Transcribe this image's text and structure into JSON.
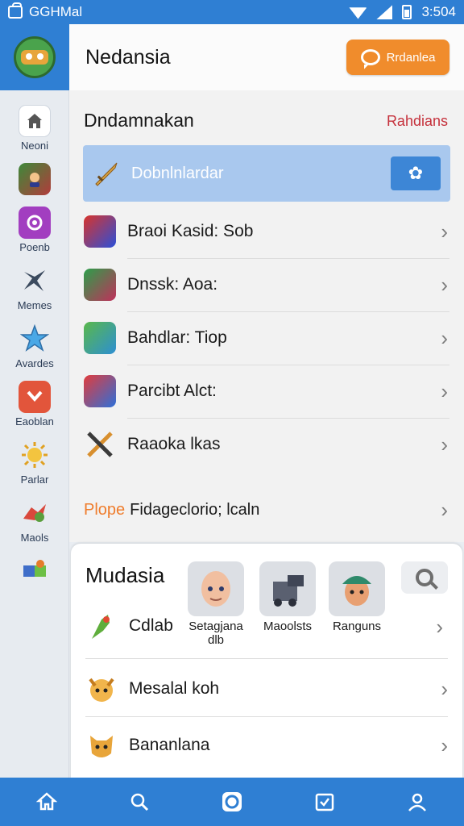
{
  "status_bar": {
    "app_label": "GGHMal",
    "time": "3:504"
  },
  "sidebar": {
    "items": [
      {
        "label": "Neoni",
        "icon": "home-icon"
      },
      {
        "label": "",
        "icon": "game-thumb-icon"
      },
      {
        "label": "Poenb",
        "icon": "swirl-icon"
      },
      {
        "label": "Memes",
        "icon": "x-shape-icon"
      },
      {
        "label": "Avardes",
        "icon": "star-icon"
      },
      {
        "label": "Eaoblan",
        "icon": "check-box-icon"
      },
      {
        "label": "Parlar",
        "icon": "sun-icon"
      },
      {
        "label": "Maols",
        "icon": "bird-icon"
      },
      {
        "label": "",
        "icon": "puzzle-icon"
      }
    ]
  },
  "header": {
    "title": "Nedansia",
    "button_label": "Rrdanlea"
  },
  "main": {
    "section_title": "Dndamnakan",
    "section_link": "Rahdians",
    "highlight": {
      "label": "Dobnlnlardar"
    },
    "rows": [
      {
        "label": "Braoi Kasid: Sob"
      },
      {
        "label": "Dnssk: Aoa:"
      },
      {
        "label": "Bahdlar: Tiop"
      },
      {
        "label": "Parcibt Alct:"
      },
      {
        "label": "Raaoka lkas"
      }
    ],
    "footer": {
      "prefix": "Plope",
      "text": "Fidageclorio; lcaln"
    }
  },
  "card": {
    "title": "Mudasia",
    "avatars": [
      {
        "label": "Setagjana dlb"
      },
      {
        "label": "Maoolsts"
      },
      {
        "label": "Ranguns"
      }
    ],
    "rows": [
      {
        "label": "Cdlab"
      },
      {
        "label": "Mesalal koh"
      },
      {
        "label": "Bananlana"
      }
    ]
  },
  "colors": {
    "primary": "#2f7fd3",
    "accent": "#f08c2c",
    "highlight": "#a9c8ee",
    "link": "#c5303b"
  }
}
